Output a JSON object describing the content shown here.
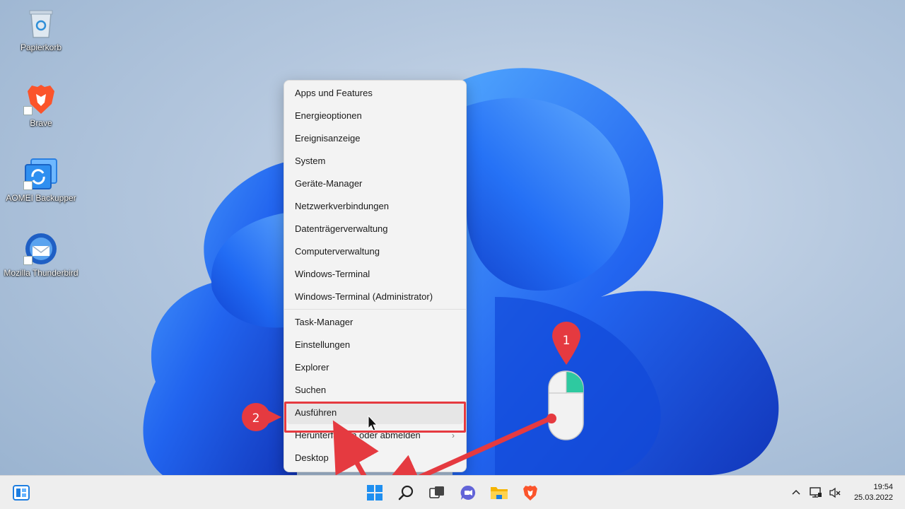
{
  "desktop": {
    "icons": [
      {
        "label": "Papierkorb",
        "icon": "recycle-bin-icon"
      },
      {
        "label": "Brave",
        "icon": "brave-icon"
      },
      {
        "label": "AOMEI Backupper",
        "icon": "aomei-backupper-icon"
      },
      {
        "label": "Mozilla Thunderbird",
        "icon": "thunderbird-icon"
      }
    ]
  },
  "context_menu": {
    "group1": [
      "Apps und Features",
      "Energieoptionen",
      "Ereignisanzeige",
      "System",
      "Geräte-Manager",
      "Netzwerkverbindungen",
      "Datenträgerverwaltung",
      "Computerverwaltung",
      "Windows-Terminal",
      "Windows-Terminal (Administrator)"
    ],
    "group2": [
      "Task-Manager",
      "Einstellungen",
      "Explorer",
      "Suchen",
      "Ausführen",
      "Herunterfahren oder abmelden",
      "Desktop"
    ],
    "hovered": "Ausführen",
    "submenu_item": "Herunterfahren oder abmelden"
  },
  "annotations": {
    "step1": "1",
    "step2": "2",
    "accent_color": "#e53a40"
  },
  "taskbar": {
    "icons": [
      "widgets-icon",
      "start-icon",
      "search-icon",
      "task-view-icon",
      "teams-chat-icon",
      "file-explorer-icon",
      "brave-icon"
    ],
    "tray_icons": [
      "chevron-up-icon",
      "network-icon",
      "volume-muted-icon"
    ],
    "time": "19:54",
    "date": "25.03.2022"
  }
}
